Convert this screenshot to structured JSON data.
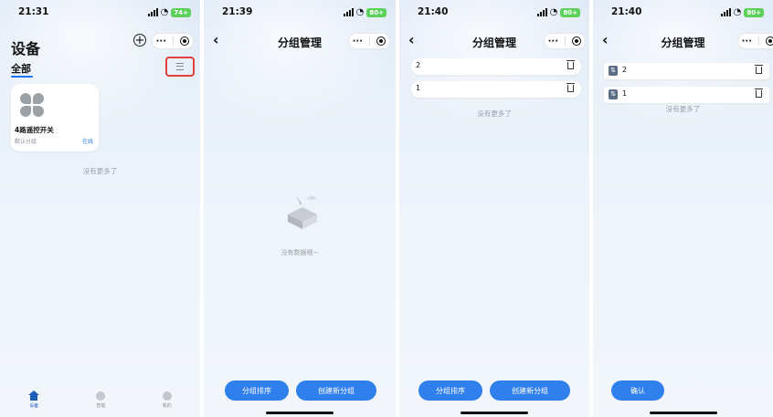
{
  "panels": [
    {
      "status_time": "21:31",
      "battery": "74+",
      "title": "设备",
      "tab_all": "全部",
      "device": {
        "name": "4路遥控开关",
        "group": "默认分组",
        "status": "在线"
      },
      "no_more": "没有更多了",
      "tabbar": [
        "设备",
        "智能",
        "我的"
      ]
    },
    {
      "status_time": "21:39",
      "battery": "80+",
      "nav_title": "分组管理",
      "empty_text": "没有数据哦~",
      "btn_sort": "分组排序",
      "btn_create": "创建新分组"
    },
    {
      "status_time": "21:40",
      "battery": "80+",
      "nav_title": "分组管理",
      "groups": [
        "2",
        "1"
      ],
      "no_more": "没有更多了",
      "btn_sort": "分组排序",
      "btn_create": "创建新分组"
    },
    {
      "status_time": "21:40",
      "battery": "80+",
      "nav_title": "分组管理",
      "groups": [
        "2",
        "1"
      ],
      "no_more": "没有更多了",
      "btn_confirm": "确认"
    }
  ],
  "icons": {
    "add": "plus-circle-icon",
    "menu": "list-menu-icon",
    "back": "chevron-left-icon",
    "more": "more-dots-icon",
    "target": "target-circle-icon",
    "trash": "trash-icon",
    "drag": "drag-handle-icon",
    "device": "clover-device-icon"
  },
  "colors": {
    "accent": "#2f80ed",
    "highlight_box": "#e04040",
    "battery": "#5bd15b"
  }
}
